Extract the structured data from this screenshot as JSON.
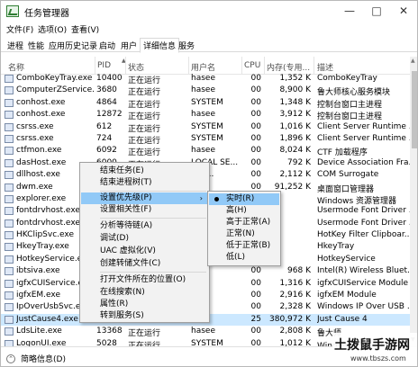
{
  "window": {
    "title": "任务管理器",
    "min": "—",
    "max": "□",
    "close": "✕"
  },
  "menu": [
    "文件(F)",
    "选项(O)",
    "查看(V)"
  ],
  "tabs": [
    "进程",
    "性能",
    "应用历史记录",
    "启动",
    "用户",
    "详细信息",
    "服务"
  ],
  "active_tab": "详细信息",
  "columns": {
    "name": "名称",
    "pid": "PID",
    "status": "状态",
    "user": "用户名",
    "cpu": "CPU",
    "mem": "内存(专用...",
    "desc": "描述"
  },
  "rows": [
    {
      "name": "ComboKeyTray.exe",
      "pid": "10400",
      "status": "正在运行",
      "user": "hasee",
      "cpu": "00",
      "mem": "1,352 K",
      "desc": "ComboKeyTray"
    },
    {
      "name": "ComputerZService...",
      "pid": "3680",
      "status": "正在运行",
      "user": "hasee",
      "cpu": "00",
      "mem": "8,900 K",
      "desc": "鲁大师核心服务模块"
    },
    {
      "name": "conhost.exe",
      "pid": "4864",
      "status": "正在运行",
      "user": "SYSTEM",
      "cpu": "00",
      "mem": "1,348 K",
      "desc": "控制台窗口主进程"
    },
    {
      "name": "conhost.exe",
      "pid": "12872",
      "status": "正在运行",
      "user": "hasee",
      "cpu": "00",
      "mem": "3,912 K",
      "desc": "控制台窗口主进程"
    },
    {
      "name": "csrss.exe",
      "pid": "612",
      "status": "正在运行",
      "user": "SYSTEM",
      "cpu": "00",
      "mem": "1,016 K",
      "desc": "Client Server Runtime ..."
    },
    {
      "name": "csrss.exe",
      "pid": "724",
      "status": "正在运行",
      "user": "SYSTEM",
      "cpu": "00",
      "mem": "1,896 K",
      "desc": "Client Server Runtime ..."
    },
    {
      "name": "ctfmon.exe",
      "pid": "6092",
      "status": "正在运行",
      "user": "hasee",
      "cpu": "00",
      "mem": "8,024 K",
      "desc": "CTF 加载程序"
    },
    {
      "name": "dasHost.exe",
      "pid": "6000",
      "status": "正在运行",
      "user": "LOCAL SE...",
      "cpu": "00",
      "mem": "792 K",
      "desc": "Device Association Fra..."
    },
    {
      "name": "dllhost.exe",
      "pid": "",
      "status": "",
      "user": "M-1...",
      "cpu": "00",
      "mem": "2,112 K",
      "desc": "COM Surrogate"
    },
    {
      "name": "dwm.exe",
      "pid": "",
      "status": "",
      "user": "",
      "cpu": "00",
      "mem": "91,252 K",
      "desc": "桌面窗口管理器"
    },
    {
      "name": "explorer.exe",
      "pid": "",
      "status": "",
      "user": "",
      "cpu": "",
      "mem": "",
      "desc": "Windows 资源管理器"
    },
    {
      "name": "fontdrvhost.exe",
      "pid": "",
      "status": "",
      "user": "",
      "cpu": "",
      "mem": "",
      "desc": "Usermode Font Driver ..."
    },
    {
      "name": "fontdrvhost.exe",
      "pid": "",
      "status": "",
      "user": "",
      "cpu": "",
      "mem": "",
      "desc": "Usermode Font Driver ..."
    },
    {
      "name": "HKClipSvc.exe",
      "pid": "",
      "status": "",
      "user": "",
      "cpu": "",
      "mem": "",
      "desc": "HotKey Filter Clipboar..."
    },
    {
      "name": "HkeyTray.exe",
      "pid": "",
      "status": "",
      "user": "",
      "cpu": "",
      "mem": "",
      "desc": "HkeyTray"
    },
    {
      "name": "HotkeyService.exe",
      "pid": "",
      "status": "",
      "user": "",
      "cpu": "",
      "mem": "",
      "desc": "HotkeyService"
    },
    {
      "name": "ibtsiva.exe",
      "pid": "",
      "status": "",
      "user": "",
      "cpu": "00",
      "mem": "968 K",
      "desc": "Intel(R) Wireless Bluet..."
    },
    {
      "name": "igfxCUIService.exe",
      "pid": "",
      "status": "",
      "user": "",
      "cpu": "00",
      "mem": "1,316 K",
      "desc": "igfxCUIService Module"
    },
    {
      "name": "igfxEM.exe",
      "pid": "",
      "status": "",
      "user": "",
      "cpu": "00",
      "mem": "2,916 K",
      "desc": "igfxEM Module"
    },
    {
      "name": "IpOverUsbSvc.exe",
      "pid": "",
      "status": "",
      "user": "",
      "cpu": "00",
      "mem": "2,328 K",
      "desc": "Windows IP Over USB ..."
    },
    {
      "name": "JustCause4.exe",
      "pid": "",
      "status": "",
      "user": "",
      "cpu": "25",
      "mem": "380,972 K",
      "desc": "Just Cause 4"
    },
    {
      "name": "LdsLite.exe",
      "pid": "13368",
      "status": "正在运行",
      "user": "hasee",
      "cpu": "00",
      "mem": "2,808 K",
      "desc": "鲁大师"
    },
    {
      "name": "LogonUI.exe",
      "pid": "5028",
      "status": "正在运行",
      "user": "SYSTEM",
      "cpu": "00",
      "mem": "1,012 K",
      "desc": "Windows 登录用户界面"
    }
  ],
  "context_menu": [
    "结束任务(E)",
    "结束进程树(T)",
    "设置优先级(P)",
    "设置相关性(F)",
    "分析等待链(A)",
    "调试(D)",
    "UAC 虚拟化(V)",
    "创建转储文件(C)",
    "打开文件所在的位置(O)",
    "在线搜索(N)",
    "属性(R)",
    "转到服务(S)"
  ],
  "submenu_arrow": "›",
  "priority_menu": [
    "实时(R)",
    "高(H)",
    "高于正常(A)",
    "正常(N)",
    "低于正常(B)",
    "低(L)"
  ],
  "priority_selected": "实时(R)",
  "status_bar": {
    "text": "简略信息(D)",
    "toggle": "⌃"
  },
  "watermark": {
    "main": "土拨鼠手游网",
    "sub": "www.tbszs.com"
  }
}
